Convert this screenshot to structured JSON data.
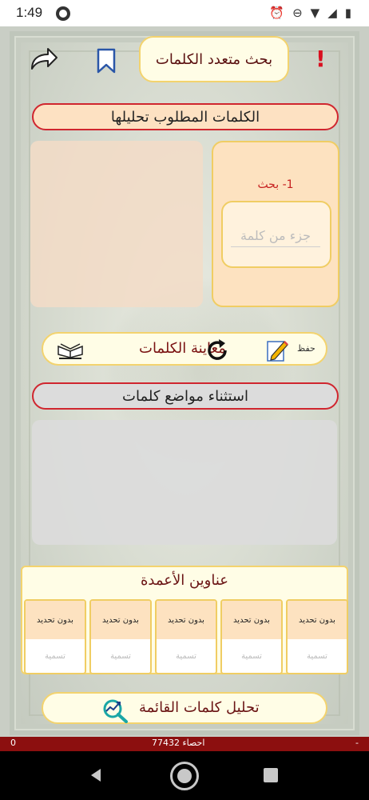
{
  "status": {
    "time": "1:49",
    "icons": [
      "alarm-icon",
      "do-not-disturb-icon",
      "wifi-icon",
      "signal-icon",
      "battery-icon"
    ]
  },
  "header": {
    "title": "بحث متعدد الكلمات",
    "alert": "!"
  },
  "words_section": {
    "title": "الكلمات المطلوب تحليلها"
  },
  "search": {
    "label": "1- بحث",
    "placeholder": "جزء من كلمة",
    "value": ""
  },
  "preview": {
    "label": "معاينة الكلمات",
    "save_label": "حفظ"
  },
  "exclude_section": {
    "title": "استثناء مواضع كلمات"
  },
  "columns": {
    "title": "عناوين الأعمدة",
    "items": [
      {
        "top": "بدون تحديد",
        "bottom": "تسمية"
      },
      {
        "top": "بدون تحديد",
        "bottom": "تسمية"
      },
      {
        "top": "بدون تحديد",
        "bottom": "تسمية"
      },
      {
        "top": "بدون تحديد",
        "bottom": "تسمية"
      },
      {
        "top": "بدون تحديد",
        "bottom": "تسمية"
      }
    ]
  },
  "analyze": {
    "label": "تحليل كلمات القائمة"
  },
  "stats": {
    "left": "0",
    "middle": "احصاء 77432",
    "right": "-"
  },
  "colors": {
    "accent_red": "#d0262f",
    "panel_peach": "#fde2c0",
    "card_cream": "#fffde6",
    "gold_border": "#f3d36e",
    "stats_bar": "#8c0f0f"
  }
}
